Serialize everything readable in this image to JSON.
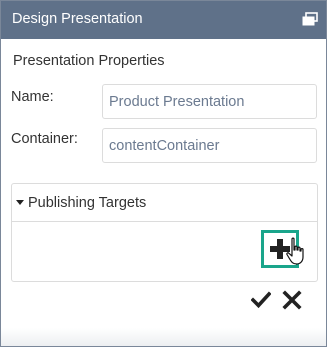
{
  "window": {
    "title": "Design Presentation",
    "titlebar_color": "#5f7189",
    "restore_icon": "restore-window-icon"
  },
  "properties": {
    "section_title": "Presentation Properties",
    "name_label": "Name:",
    "name_value": "Product Presentation",
    "container_label": "Container:",
    "container_value": "contentContainer"
  },
  "publishing": {
    "title": "Publishing Targets",
    "expanded": true,
    "add_icon": "plus-icon",
    "accent_color": "#1aa58b"
  },
  "actions": {
    "confirm_icon": "check-icon",
    "cancel_icon": "close-icon"
  }
}
